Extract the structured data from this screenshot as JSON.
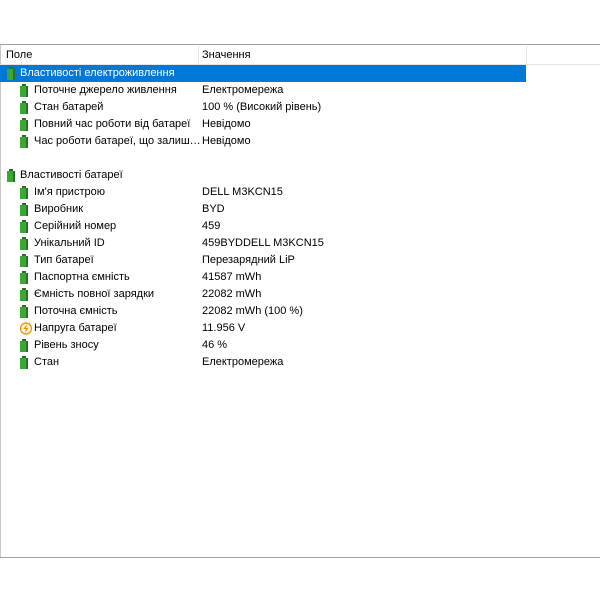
{
  "columns": {
    "field": "Поле",
    "value": "Значення"
  },
  "power_group": {
    "title": "Властивості електроживлення",
    "items": [
      {
        "label": "Поточне джерело живлення",
        "value": "Електромережа"
      },
      {
        "label": "Стан батарей",
        "value": "100 % (Високий рівень)"
      },
      {
        "label": "Повний час роботи від батареї",
        "value": "Невідомо"
      },
      {
        "label": "Час роботи батареї, що залиш…",
        "value": "Невідомо"
      }
    ]
  },
  "battery_group": {
    "title": "Властивості батареї",
    "items": [
      {
        "label": "Ім'я пристрою",
        "value": "DELL M3KCN15",
        "icon": "battery-icon"
      },
      {
        "label": "Виробник",
        "value": "BYD",
        "icon": "battery-icon"
      },
      {
        "label": "Серійний номер",
        "value": "459",
        "icon": "battery-icon"
      },
      {
        "label": "Унікальний ID",
        "value": "459BYDDELL M3KCN15",
        "icon": "battery-icon"
      },
      {
        "label": "Тип батареї",
        "value": "Перезарядний LiP",
        "icon": "battery-icon"
      },
      {
        "label": "Паспортна ємність",
        "value": "41587 mWh",
        "icon": "battery-icon"
      },
      {
        "label": "Ємність повної зарядки",
        "value": "22082 mWh",
        "icon": "battery-icon"
      },
      {
        "label": "Поточна ємність",
        "value": "22082 mWh  (100 %)",
        "icon": "battery-icon"
      },
      {
        "label": "Напруга батареї",
        "value": "11.956 V",
        "icon": "voltage-icon"
      },
      {
        "label": "Рівень зносу",
        "value": "46 %",
        "icon": "battery-icon"
      },
      {
        "label": "Стан",
        "value": "Електромережа",
        "icon": "battery-icon"
      }
    ]
  },
  "colors": {
    "selection": "#0078d7",
    "battery_green": "#3aa832",
    "battery_dark": "#2c6e2a",
    "voltage_orange": "#f08a00"
  }
}
